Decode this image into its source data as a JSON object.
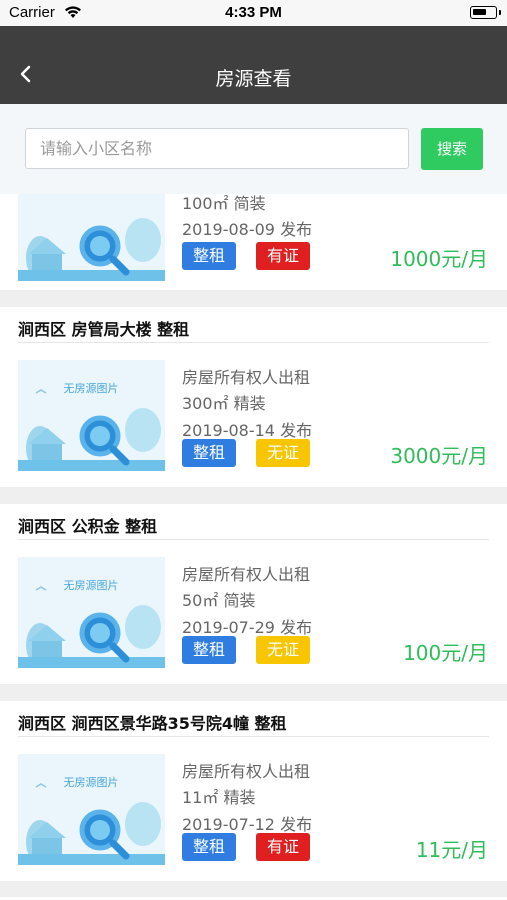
{
  "status_bar": {
    "carrier": "Carrier",
    "time": "4:33 PM"
  },
  "nav": {
    "title": "房源查看"
  },
  "search": {
    "placeholder": "请输入小区名称",
    "button": "搜索"
  },
  "image_placeholder_text": "无房源图片",
  "listings": [
    {
      "header": "",
      "owner": "",
      "area": "100㎡ 简装",
      "date": "2019-08-09 发布",
      "tag_type": "整租",
      "tag_cert": "有证",
      "cert_color": "red",
      "price": "1000元/月"
    },
    {
      "header": "涧西区 房管局大楼 整租",
      "owner": "房屋所有权人出租",
      "area": "300㎡ 精装",
      "date": "2019-08-14 发布",
      "tag_type": "整租",
      "tag_cert": "无证",
      "cert_color": "yellow",
      "price": "3000元/月"
    },
    {
      "header": "涧西区 公积金 整租",
      "owner": "房屋所有权人出租",
      "area": "50㎡ 简装",
      "date": "2019-07-29 发布",
      "tag_type": "整租",
      "tag_cert": "无证",
      "cert_color": "yellow",
      "price": "100元/月"
    },
    {
      "header": "涧西区 涧西区景华路35号院4幢 整租",
      "owner": "房屋所有权人出租",
      "area": "11㎡ 精装",
      "date": "2019-07-12 发布",
      "tag_type": "整租",
      "tag_cert": "有证",
      "cert_color": "red",
      "price": "11元/月"
    }
  ],
  "colors": {
    "nav_bg": "#3f3f3f",
    "search_button": "#2fcb60",
    "price": "#2fbd5a",
    "tag_blue": "#2f7de0",
    "tag_red": "#e02020",
    "tag_yellow": "#f7c600"
  }
}
